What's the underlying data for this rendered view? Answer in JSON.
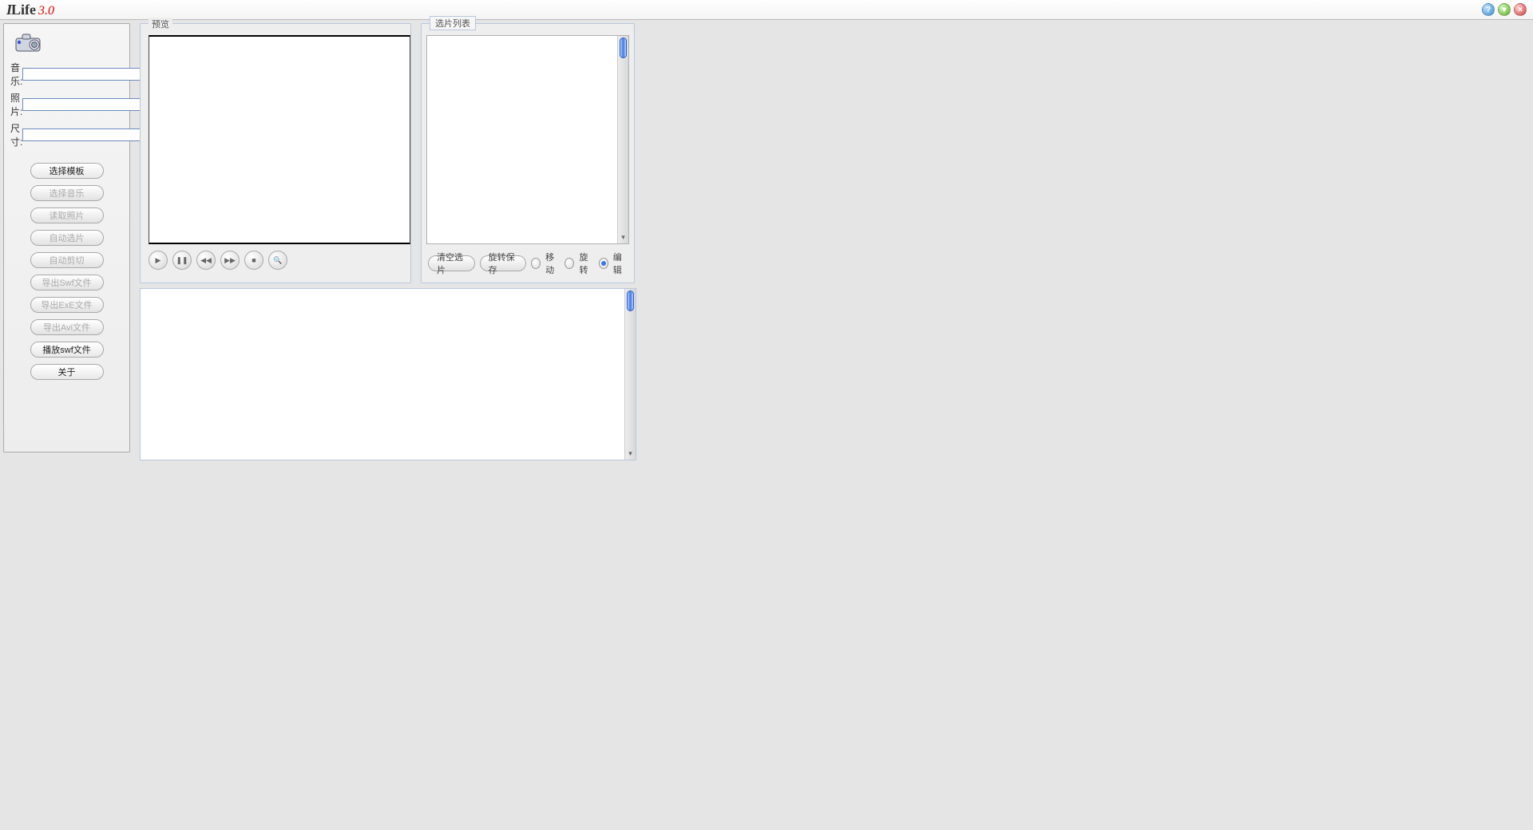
{
  "app": {
    "name_i": "I",
    "name_life": "Life",
    "version": "3.0"
  },
  "sidebar": {
    "fields": {
      "music_label": "音乐:",
      "music_value": "",
      "photo_label": "照片:",
      "photo_value": "",
      "size_label": "尺寸:",
      "size_value": ""
    },
    "buttons": [
      {
        "label": "选择模板",
        "enabled": true
      },
      {
        "label": "选择音乐",
        "enabled": false
      },
      {
        "label": "读取照片",
        "enabled": false
      },
      {
        "label": "自动选片",
        "enabled": false
      },
      {
        "label": "自动剪切",
        "enabled": false
      },
      {
        "label": "导出Swf文件",
        "enabled": false
      },
      {
        "label": "导出ExE文件",
        "enabled": false
      },
      {
        "label": "导出Avi文件",
        "enabled": false
      },
      {
        "label": "播放swf文件",
        "enabled": true
      },
      {
        "label": "关于",
        "enabled": true
      }
    ]
  },
  "preview": {
    "legend": "预览",
    "controls": {
      "play": "▶",
      "pause": "❚❚",
      "rewind": "◀◀",
      "forward": "▶▶",
      "stop": "■",
      "zoom": "🔍"
    }
  },
  "piclist": {
    "legend": "选片列表",
    "tools": {
      "clear": "清空选片",
      "saverotate": "旋转保存",
      "radios": {
        "move": "移动",
        "rotate": "旋转",
        "edit": "编辑",
        "selected": "edit"
      }
    }
  }
}
